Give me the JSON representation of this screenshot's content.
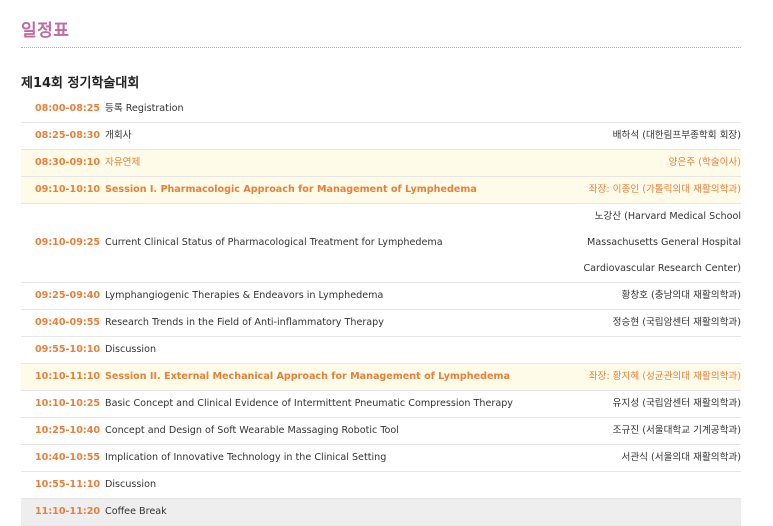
{
  "page_title": "일정표",
  "section_title": "제14회 정기학술대회",
  "rows": [
    {
      "time": "08:00-08:25",
      "title": "등록 Registration",
      "speaker": ""
    },
    {
      "time": "08:25-08:30",
      "title": "개회사",
      "speaker": "배하석 (대한림프부종학회 회장)"
    },
    {
      "time": "08:30-09:10",
      "title": "자유연제",
      "speaker": "양은주 (학술이사)"
    },
    {
      "time": "09:10-10:10",
      "title": "Session I. Pharmacologic Approach for Management of Lymphedema",
      "speaker": "좌장: 이종인 (가톨릭의대 재활의학과)"
    },
    {
      "time": "09:10-09:25",
      "title": "Current Clinical Status of Pharmacological Treatment for Lymphedema",
      "speaker": "노강산 (Harvard Medical School Massachusetts General Hospital Cardiovascular Research Center)"
    },
    {
      "time": "09:25-09:40",
      "title": "Lymphangiogenic Therapies & Endeavors in Lymphedema",
      "speaker": "황창호 (충남의대 재활의학과)"
    },
    {
      "time": "09:40-09:55",
      "title": "Research Trends in the Field of Anti-inflammatory Therapy",
      "speaker": "정승현 (국립암센터 재활의학과)"
    },
    {
      "time": "09:55-10:10",
      "title": "Discussion",
      "speaker": ""
    },
    {
      "time": "10:10-11:10",
      "title": "Session II. External Mechanical Approach for Management of Lymphedema",
      "speaker": "좌장: 황지혜 (성균관의대 재활의학과)"
    },
    {
      "time": "10:10-10:25",
      "title": "Basic Concept and Clinical Evidence of Intermittent Pneumatic Compression Therapy",
      "speaker": "유지성 (국립암센터 재활의학과)"
    },
    {
      "time": "10:25-10:40",
      "title": "Concept and Design of Soft Wearable Massaging Robotic Tool",
      "speaker": "조규진 (서울대학교 기계공학과)"
    },
    {
      "time": "10:40-10:55",
      "title": "Implication of Innovative Technology in the Clinical Setting",
      "speaker": "서관식 (서울의대 재활의학과)"
    },
    {
      "time": "10:55-11:10",
      "title": "Discussion",
      "speaker": ""
    },
    {
      "time": "11:10-11:20",
      "title": "Coffee Break",
      "speaker": ""
    }
  ]
}
